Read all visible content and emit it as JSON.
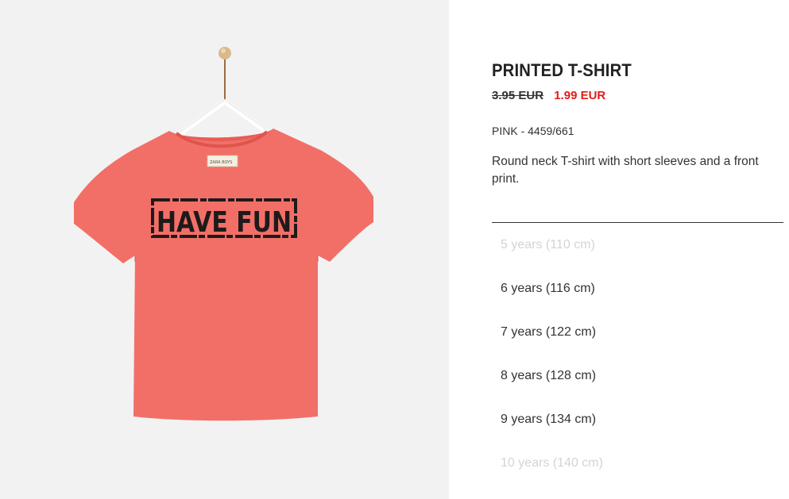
{
  "product": {
    "title": "PRINTED T-SHIRT",
    "old_price": "3.95 EUR",
    "new_price": "1.99 EUR",
    "color_ref": "PINK - 4459/661",
    "description": "Round neck T-shirt with short sleeves and a front print.",
    "print_text": "HAVE FUN",
    "garment_color": "#f26f68",
    "sale_price_color": "#e41b17"
  },
  "sizes": [
    {
      "label": "5 years (110 cm)",
      "available": false
    },
    {
      "label": "6 years (116 cm)",
      "available": true
    },
    {
      "label": "7 years (122 cm)",
      "available": true
    },
    {
      "label": "8 years (128 cm)",
      "available": true
    },
    {
      "label": "9 years (134 cm)",
      "available": true
    },
    {
      "label": "10 years (140 cm)",
      "available": false
    }
  ]
}
